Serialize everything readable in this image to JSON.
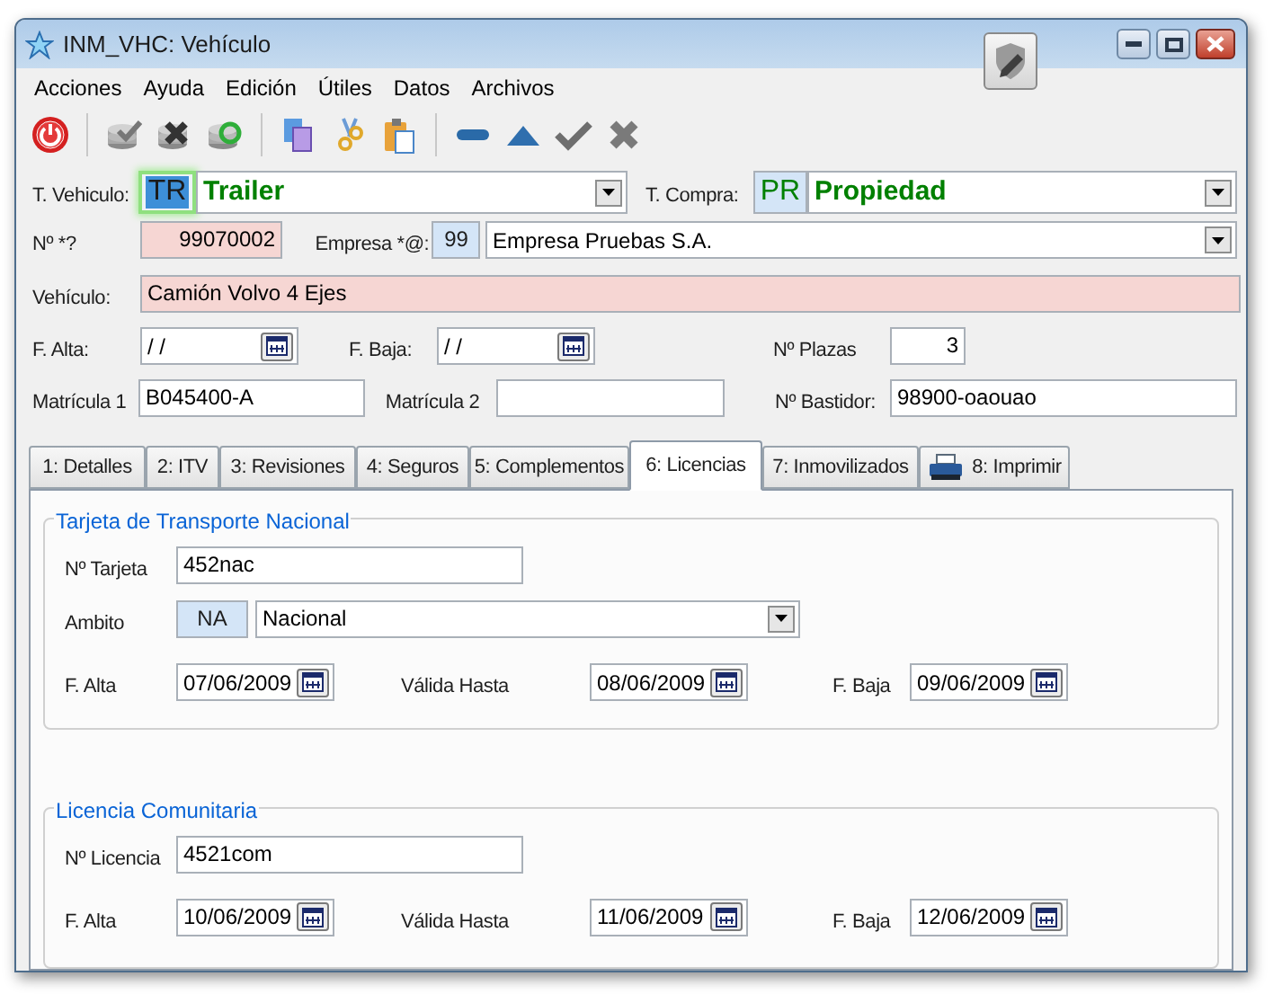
{
  "window": {
    "title": "INM_VHC: Vehículo"
  },
  "menu": [
    "Acciones",
    "Ayuda",
    "Edición",
    "Útiles",
    "Datos",
    "Archivos"
  ],
  "header": {
    "tipo_vehiculo": {
      "label": "T. Vehiculo:",
      "code": "TR",
      "value": "Trailer",
      "focused": true
    },
    "tipo_compra": {
      "label": "T. Compra:",
      "code": "PR",
      "value": "Propiedad",
      "focused": false
    },
    "numero": {
      "label": "Nº *?",
      "value": "99070002",
      "required": true
    },
    "empresa": {
      "label": "Empresa *@:",
      "code": "99",
      "value": "Empresa Pruebas S.A."
    },
    "vehiculo": {
      "label": "Vehículo:",
      "value": "Camión Volvo 4 Ejes",
      "required": true
    },
    "f_alta": {
      "label": "F. Alta:",
      "value": "/ /"
    },
    "f_baja": {
      "label": "F. Baja:",
      "value": "/ /"
    },
    "plazas": {
      "label": "Nº Plazas",
      "value": "3"
    },
    "matricula_1": {
      "label": "Matrícula 1",
      "value": "B045400-A"
    },
    "matricula_2": {
      "label": "Matrícula 2"
    },
    "bastidor": {
      "label": "Nº Bastidor:",
      "value": "98900-oaouao"
    }
  },
  "tabs": [
    {
      "label": "1: Detalles",
      "selected": false,
      "kind": "plain"
    },
    {
      "label": "2: ITV",
      "selected": false,
      "kind": "plain"
    },
    {
      "label": "3: Revisiones",
      "selected": false,
      "kind": "plain"
    },
    {
      "label": "4: Seguros",
      "selected": false,
      "kind": "plain"
    },
    {
      "label": "5: Complementos",
      "selected": false,
      "kind": "plain"
    },
    {
      "label": "6: Licencias",
      "selected": true,
      "kind": "plain"
    },
    {
      "label": "7: Inmovilizados",
      "selected": false,
      "kind": "plain"
    },
    {
      "label": "8: Imprimir",
      "selected": false,
      "kind": "printer"
    }
  ],
  "tarjeta": {
    "title": "Tarjeta de Transporte Nacional",
    "numero": {
      "label": "Nº Tarjeta",
      "value": "452nac"
    },
    "ambito": {
      "label": "Ambito",
      "code": "NA",
      "value": "Nacional"
    },
    "dates": [
      {
        "label": "F. Alta",
        "value": "07/06/2009"
      },
      {
        "label": "Válida Hasta",
        "value": "08/06/2009"
      },
      {
        "label": "F. Baja",
        "value": "09/06/2009"
      }
    ]
  },
  "licencia": {
    "title": "Licencia Comunitaria",
    "numero": {
      "label": "Nº Licencia",
      "value": "4521com"
    },
    "dates": [
      {
        "label": "F. Alta",
        "value": "10/06/2009"
      },
      {
        "label": "Válida Hasta",
        "value": "11/06/2009"
      },
      {
        "label": "F. Baja",
        "value": "12/06/2009"
      }
    ]
  }
}
